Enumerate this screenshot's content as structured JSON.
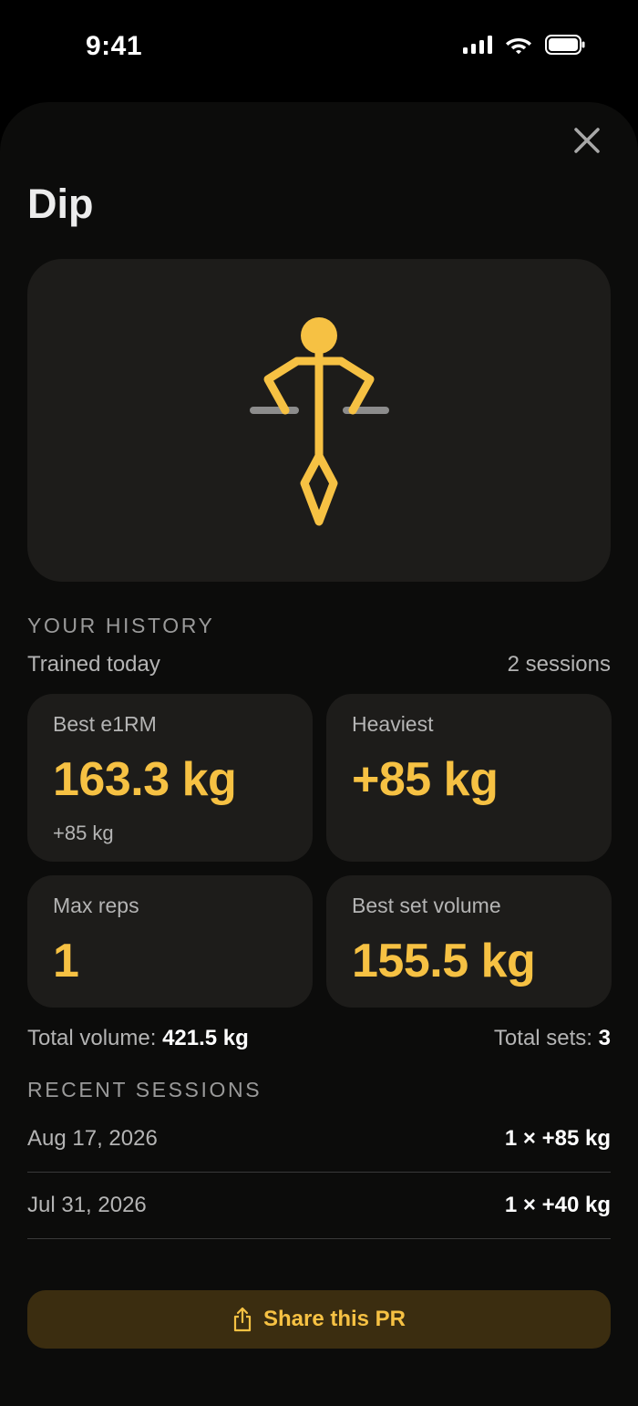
{
  "status": {
    "time": "9:41"
  },
  "exercise": {
    "name": "Dip"
  },
  "history": {
    "heading": "YOUR HISTORY",
    "trained": "Trained today",
    "sessions_count": "2 sessions",
    "cards": [
      {
        "label": "Best e1RM",
        "value": "163.3 kg",
        "sub": "+85 kg"
      },
      {
        "label": "Heaviest",
        "value": "+85 kg"
      },
      {
        "label": "Max reps",
        "value": "1"
      },
      {
        "label": "Best set volume",
        "value": "155.5 kg"
      }
    ],
    "total_volume_label": "Total volume:",
    "total_volume_value": "421.5 kg",
    "total_sets_label": "Total sets:",
    "total_sets_value": "3"
  },
  "recent": {
    "heading": "RECENT SESSIONS",
    "sessions": [
      {
        "date": "Aug 17, 2026",
        "value": "1 × +85 kg"
      },
      {
        "date": "Jul 31, 2026",
        "value": "1 × +40 kg"
      }
    ]
  },
  "share": {
    "label": "Share this PR"
  },
  "colors": {
    "accent": "#f6c143",
    "card": "#1d1c1a",
    "sheet": "#0c0c0b"
  }
}
